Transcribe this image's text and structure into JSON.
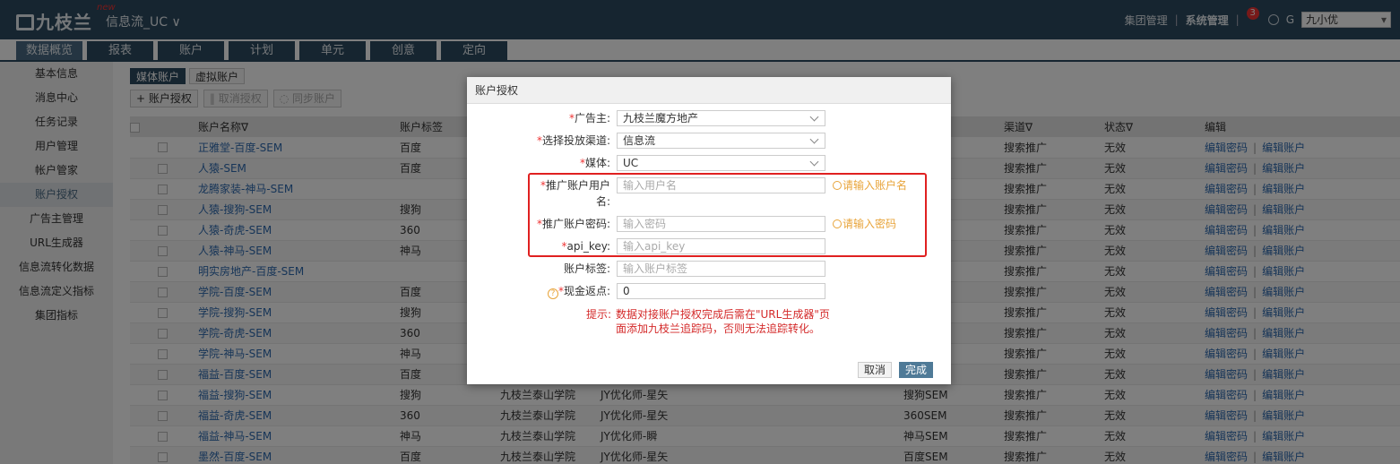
{
  "header": {
    "brand": "九枝兰",
    "new_tag": "new",
    "channel": "信息流_UC ∨",
    "group_mgmt": "集团管理",
    "sys_mgmt": "系统管理",
    "notify_count": "3",
    "help_letter": "G",
    "user": "九小优"
  },
  "tabs": [
    "数据概览",
    "报表",
    "账户",
    "计划",
    "单元",
    "创意",
    "定向"
  ],
  "sidebar": [
    "基本信息",
    "消息中心",
    "任务记录",
    "用户管理",
    "帐户管家",
    "账户授权",
    "广告主管理",
    "URL生成器",
    "信息流转化数据",
    "信息流定义指标",
    "集团指标"
  ],
  "subtabs": [
    "媒体账户",
    "虚拟账户"
  ],
  "actions": {
    "add": "+ 账户授权",
    "cancel": "‖ 取消授权",
    "sync": "◌ 同步账户"
  },
  "table": {
    "headers": [
      "账户名称∇",
      "账户标签",
      "",
      "",
      "",
      "渠道∇",
      "状态∇",
      "编辑"
    ],
    "edit_pwd": "编辑密码",
    "edit_acc": "编辑账户",
    "rows": [
      [
        "正雅堂-百度-SEM",
        "百度",
        "",
        "",
        "",
        "搜索推广",
        "无效"
      ],
      [
        "人猿-SEM",
        "百度",
        "",
        "",
        "",
        "搜索推广",
        "无效"
      ],
      [
        "龙腾家装-神马-SEM",
        "",
        "",
        "",
        "",
        "搜索推广",
        "无效"
      ],
      [
        "人猿-搜狗-SEM",
        "搜狗",
        "",
        "",
        "",
        "搜索推广",
        "无效"
      ],
      [
        "人猿-奇虎-SEM",
        "360",
        "",
        "",
        "",
        "搜索推广",
        "无效"
      ],
      [
        "人猿-神马-SEM",
        "神马",
        "",
        "",
        "",
        "搜索推广",
        "无效"
      ],
      [
        "明实房地产-百度-SEM",
        "",
        "",
        "",
        "",
        "搜索推广",
        "无效"
      ],
      [
        "学院-百度-SEM",
        "百度",
        "",
        "",
        "",
        "搜索推广",
        "无效"
      ],
      [
        "学院-搜狗-SEM",
        "搜狗",
        "",
        "",
        "",
        "搜索推广",
        "无效"
      ],
      [
        "学院-奇虎-SEM",
        "360",
        "",
        "",
        "",
        "搜索推广",
        "无效"
      ],
      [
        "学院-神马-SEM",
        "神马",
        "",
        "",
        "",
        "搜索推广",
        "无效"
      ],
      [
        "福益-百度-SEM",
        "百度",
        "",
        "",
        "",
        "搜索推广",
        "无效"
      ],
      [
        "福益-搜狗-SEM",
        "搜狗",
        "九枝兰泰山学院",
        "JY优化师-星矢",
        "搜狗SEM",
        "搜索推广",
        "无效"
      ],
      [
        "福益-奇虎-SEM",
        "360",
        "九枝兰泰山学院",
        "JY优化师-星矢",
        "360SEM",
        "搜索推广",
        "无效"
      ],
      [
        "福益-神马-SEM",
        "神马",
        "九枝兰泰山学院",
        "JY优化师-瞬",
        "神马SEM",
        "搜索推广",
        "无效"
      ],
      [
        "墨然-百度-SEM",
        "百度",
        "九枝兰泰山学院",
        "JY优化师-星矢",
        "百度SEM",
        "搜索推广",
        "无效"
      ]
    ]
  },
  "modal": {
    "title": "账户授权",
    "advertiser_label": "广告主:",
    "advertiser_value": "九枝兰魔方地产",
    "channel_label": "选择投放渠道:",
    "channel_value": "信息流",
    "media_label": "媒体:",
    "media_value": "UC",
    "username_label": "推广账户用户名:",
    "username_placeholder": "输入用户名",
    "username_hint": "请输入账户名",
    "password_label": "推广账户密码:",
    "password_placeholder": "输入密码",
    "password_hint": "请输入密码",
    "apikey_label": "api_key:",
    "apikey_placeholder": "输入api_key",
    "tag_label": "账户标签:",
    "tag_placeholder": "输入账户标签",
    "rebate_label": "现金返点:",
    "rebate_value": "0",
    "tip_label": "提示:",
    "tip_text": "数据对接账户授权完成后需在\"URL生成器\"页面添加九枝兰追踪码，否则无法追踪转化。",
    "cancel": "取消",
    "ok": "完成"
  },
  "colors": {
    "nav": "#2d4a60",
    "link": "#2f6bb0",
    "warn": "#e8a43a",
    "danger": "#e02020",
    "primary_btn": "#4f7a97"
  }
}
